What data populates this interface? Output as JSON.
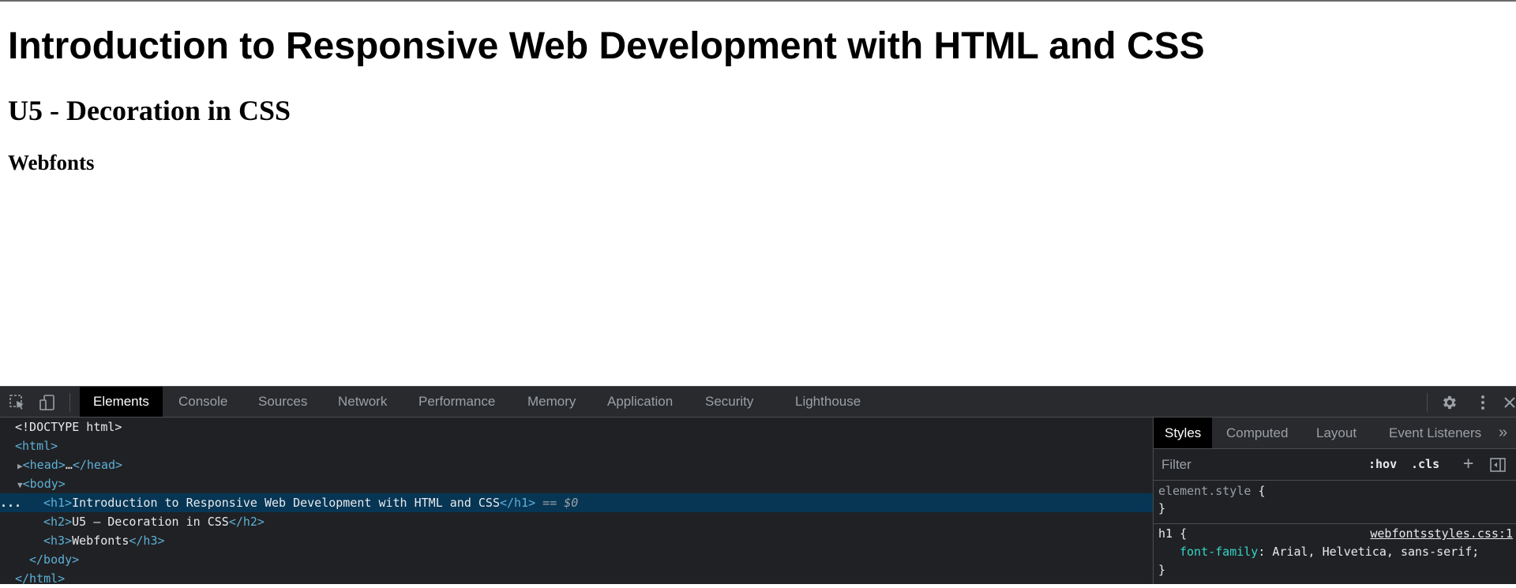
{
  "page": {
    "h1": "Introduction to Responsive Web Development with HTML and CSS",
    "h2": "U5 - Decoration in CSS",
    "h3": "Webfonts"
  },
  "devtools": {
    "tabs": [
      {
        "label": "Elements",
        "active": true
      },
      {
        "label": "Console"
      },
      {
        "label": "Sources"
      },
      {
        "label": "Network"
      },
      {
        "label": "Performance"
      },
      {
        "label": "Memory"
      },
      {
        "label": "Application"
      },
      {
        "label": "Security"
      },
      {
        "label": "Lighthouse"
      }
    ],
    "icons": {
      "inspect": "inspect-element-icon",
      "device": "device-toolbar-icon",
      "settings": "gear-icon",
      "more": "more-vertical-icon",
      "close": "close-icon"
    },
    "dom": {
      "doctype": "<!DOCTYPE html>",
      "html_open": "<html>",
      "head_open": "<head>",
      "head_ellipsis": "…",
      "head_close": "</head>",
      "body_open": "<body>",
      "h1_open": "<h1>",
      "h1_text": "Introduction to Responsive Web Development with HTML and CSS",
      "h1_close": "</h1>",
      "selected_marker": "== $0",
      "ellipsis_marker": "...",
      "h2_open": "<h2>",
      "h2_text": "U5 – Decoration in CSS",
      "h2_close": "</h2>",
      "h3_open": "<h3>",
      "h3_text": "Webfonts",
      "h3_close": "</h3>",
      "body_close": "</body>",
      "html_close": "</html>"
    },
    "styles": {
      "tabs": [
        {
          "label": "Styles",
          "active": true
        },
        {
          "label": "Computed"
        },
        {
          "label": "Layout"
        },
        {
          "label": "Event Listeners"
        }
      ],
      "overflow": "»",
      "filter_placeholder": "Filter",
      "hov": ":hov",
      "cls": ".cls",
      "add": "+",
      "element_style_selector": "element.style",
      "open_brace": "{",
      "close_brace": "}",
      "rule_selector": "h1",
      "rule_source": "webfontsstyles.css:1",
      "prop_name": "font-family",
      "prop_value": "Arial, Helvetica, sans-serif;"
    }
  }
}
